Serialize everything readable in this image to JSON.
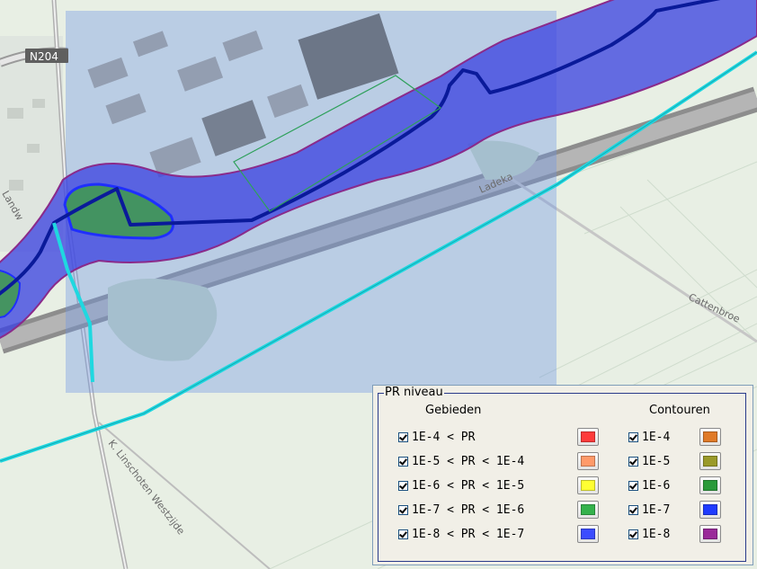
{
  "map": {
    "road_label": "N204",
    "street_labels": [
      "Cattenbroe",
      "K. Linschoten Westzijde",
      "Ladeka",
      "Landw"
    ]
  },
  "legend": {
    "title": "PR niveau",
    "areas_header": "Gebieden",
    "contours_header": "Contouren",
    "areas": [
      {
        "label": "1E-4 < PR",
        "color": "#ff3b3b",
        "checked": true
      },
      {
        "label": "1E-5 < PR < 1E-4",
        "color": "#ff9a6a",
        "checked": true
      },
      {
        "label": "1E-6 < PR < 1E-5",
        "color": "#ffff33",
        "checked": true
      },
      {
        "label": "1E-7 < PR < 1E-6",
        "color": "#34b24c",
        "checked": true
      },
      {
        "label": "1E-8 < PR < 1E-7",
        "color": "#3b4cff",
        "checked": true
      }
    ],
    "contours": [
      {
        "label": "1E-4",
        "color": "#e07a28",
        "checked": true
      },
      {
        "label": "1E-5",
        "color": "#9a9a2a",
        "checked": true
      },
      {
        "label": "1E-6",
        "color": "#2a9a3a",
        "checked": true
      },
      {
        "label": "1E-7",
        "color": "#1f3bff",
        "checked": true
      },
      {
        "label": "1E-8",
        "color": "#9a2a9a",
        "checked": true
      }
    ]
  }
}
